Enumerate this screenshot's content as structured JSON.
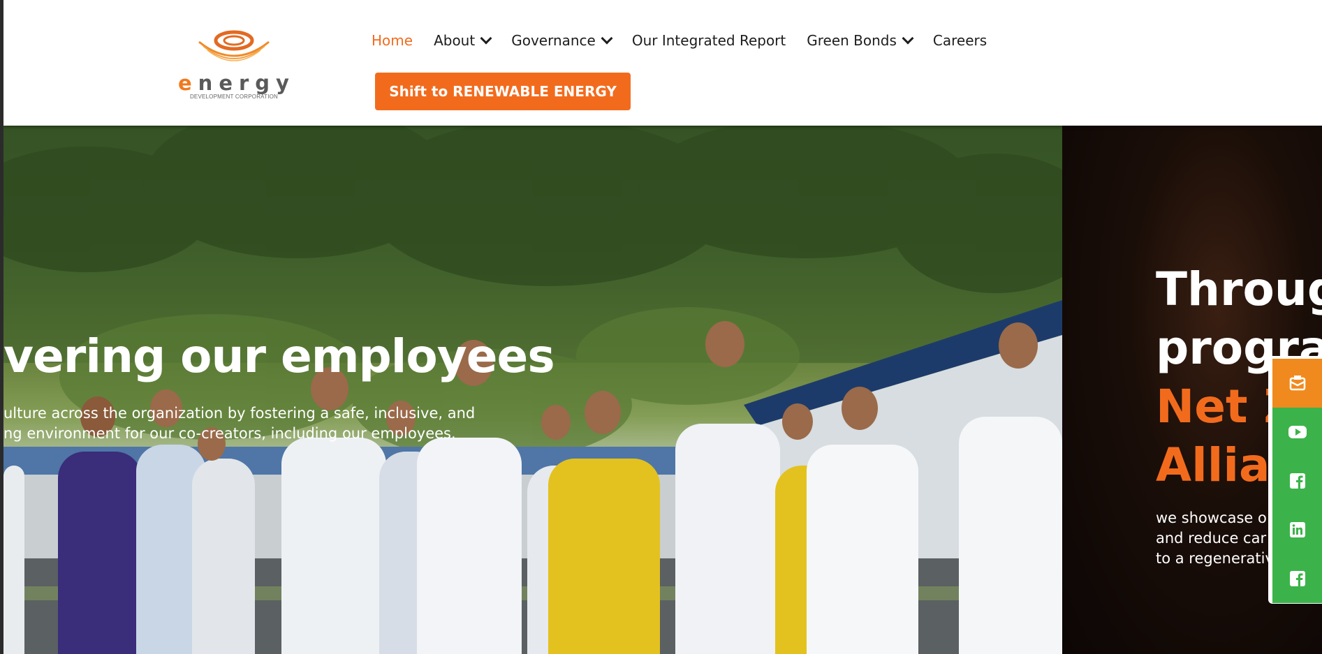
{
  "logo": {
    "letter_e": "e",
    "word_rest": "nergy",
    "subtitle": "DEVELOPMENT CORPORATION"
  },
  "nav": {
    "items": [
      {
        "label": "Home",
        "active": true,
        "dropdown": false
      },
      {
        "label": "About",
        "active": false,
        "dropdown": true
      },
      {
        "label": "Governance",
        "active": false,
        "dropdown": true
      },
      {
        "label": "Our Integrated Report",
        "active": false,
        "dropdown": false
      },
      {
        "label": "Green Bonds",
        "active": false,
        "dropdown": true
      },
      {
        "label": "Careers",
        "active": false,
        "dropdown": false
      }
    ],
    "cta_label": "Shift to RENEWABLE ENERGY"
  },
  "hero": {
    "title": "vering our employees",
    "subtitle_lines": [
      "ulture across the organization by fostering a safe, inclusive, and",
      "ng environment for our co-creators, including our employees."
    ]
  },
  "slide2": {
    "title_lines": [
      "Throug",
      "progra"
    ],
    "highlight_lines": [
      "Net Z",
      "Allia"
    ],
    "subtitle_lines": [
      "we showcase o",
      "and reduce car",
      "to a regenerativ"
    ]
  },
  "social": {
    "icons": [
      "newsletter-icon",
      "youtube-icon",
      "facebook-icon",
      "linkedin-icon",
      "facebook-icon"
    ]
  },
  "colors": {
    "accent": "#f26b1d",
    "social_green": "#3cb34a",
    "social_orange": "#f08a1e"
  }
}
